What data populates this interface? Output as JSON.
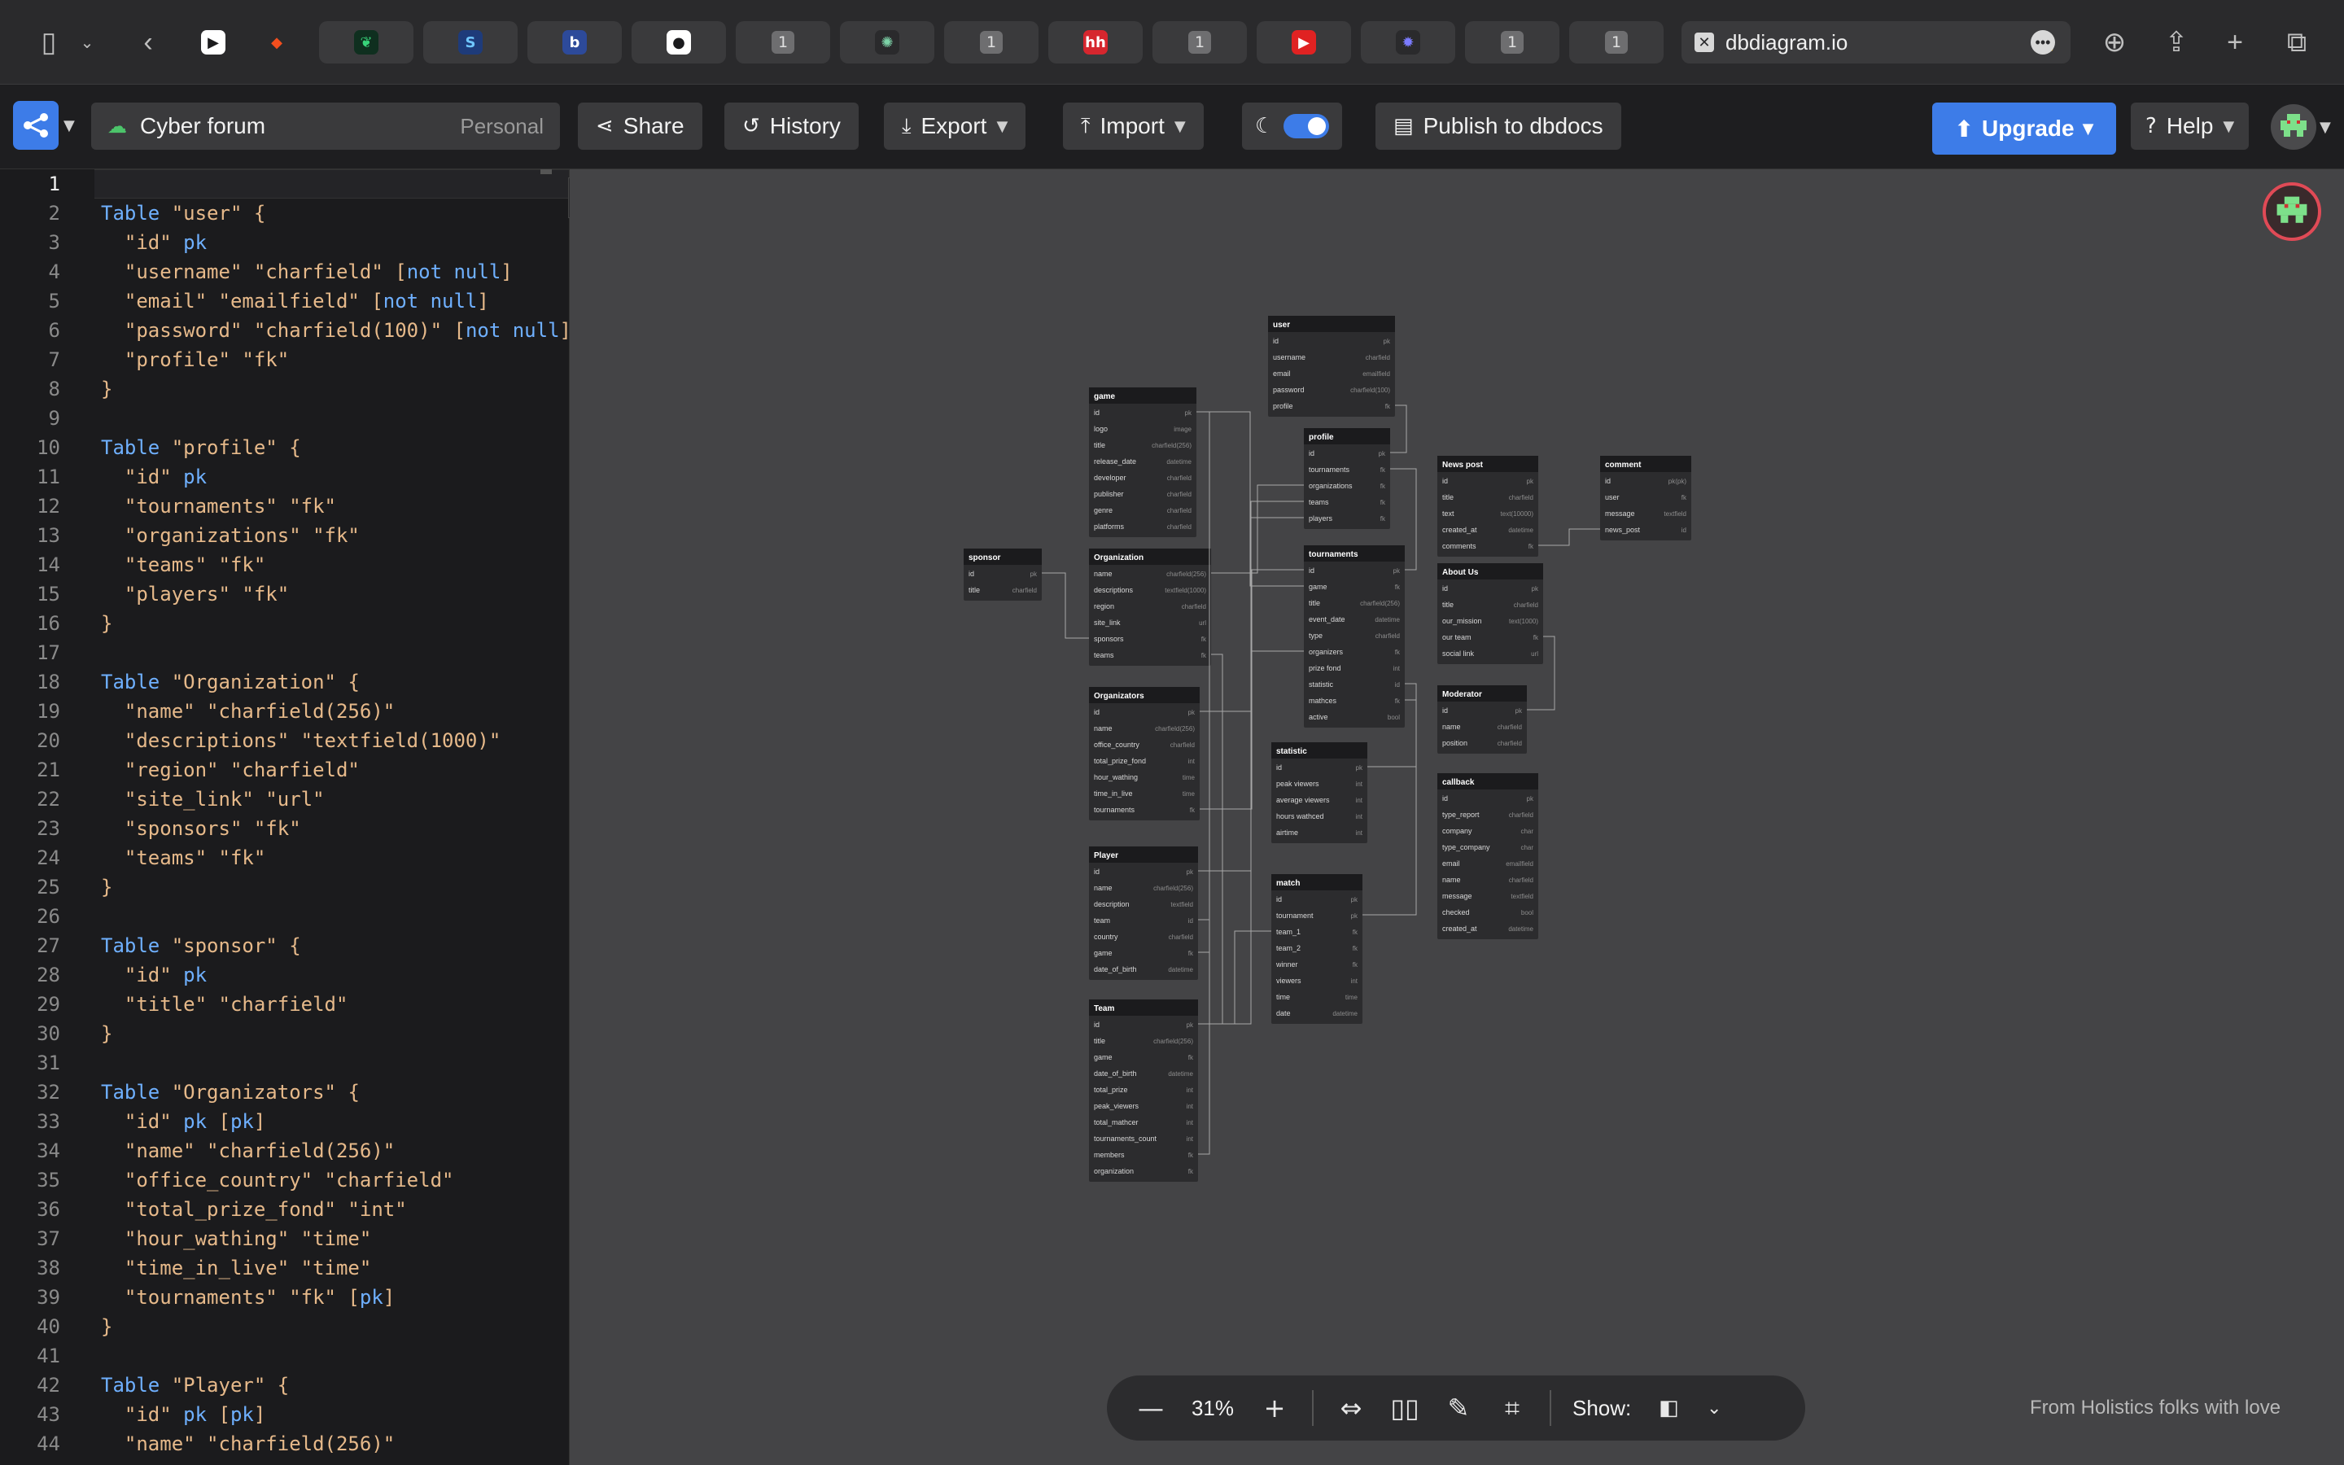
{
  "browser": {
    "url": "dbdiagram.io",
    "tab_count_label": "1",
    "tabs": [
      {
        "icon": "play-logo-icon",
        "color": "#ffffff",
        "glyph": "▶",
        "fg": "#1b1b1d"
      },
      {
        "icon": "figma-logo-icon",
        "color": "#2a2a2c",
        "glyph": "◆",
        "fg": "#f24e1e"
      },
      {
        "icon": "leaf-logo-icon",
        "color": "#0f2f1f",
        "glyph": "❦",
        "fg": "#38d47a"
      },
      {
        "icon": "s-logo-icon",
        "color": "#1e3b7a",
        "glyph": "S",
        "fg": "#6fc6ff"
      },
      {
        "icon": "b-logo-icon",
        "color": "#2d4a9a",
        "glyph": "b",
        "fg": "#ffffff"
      },
      {
        "icon": "github-logo-icon",
        "color": "#ffffff",
        "glyph": "●",
        "fg": "#1b1b1d"
      },
      {
        "icon": "numbered-tab-icon",
        "color": "",
        "glyph": "1",
        "fg": ""
      },
      {
        "icon": "openai-logo-icon",
        "color": "#2a2a2c",
        "glyph": "✺",
        "fg": "#7dd3a8"
      },
      {
        "icon": "numbered-tab-icon",
        "color": "",
        "glyph": "1",
        "fg": ""
      },
      {
        "icon": "hh-logo-icon",
        "color": "#d6262e",
        "glyph": "hh",
        "fg": "#ffffff"
      },
      {
        "icon": "numbered-tab-icon",
        "color": "",
        "glyph": "1",
        "fg": ""
      },
      {
        "icon": "youtube-logo-icon",
        "color": "#e02222",
        "glyph": "▶",
        "fg": "#ffffff"
      },
      {
        "icon": "bug-logo-icon",
        "color": "#2a2a2c",
        "glyph": "✹",
        "fg": "#7b7bff"
      },
      {
        "icon": "numbered-tab-icon",
        "color": "",
        "glyph": "1",
        "fg": ""
      },
      {
        "icon": "numbered-tab-icon",
        "color": "",
        "glyph": "1",
        "fg": ""
      }
    ]
  },
  "toolbar": {
    "project_name": "Cyber forum",
    "visibility": "Personal",
    "share": "Share",
    "history": "History",
    "export": "Export",
    "import": "Import",
    "publish": "Publish to dbdocs",
    "upgrade": "Upgrade",
    "help": "Help",
    "dark_mode_on": true
  },
  "editor": {
    "current_line": 1,
    "lines": [
      "",
      "Table \"user\" {",
      "  \"id\" pk",
      "  \"username\" \"charfield\" [not null]",
      "  \"email\" \"emailfield\" [not null]",
      "  \"password\" \"charfield(100)\" [not null]",
      "  \"profile\" \"fk\"",
      "}",
      "",
      "Table \"profile\" {",
      "  \"id\" pk",
      "  \"tournaments\" \"fk\"",
      "  \"organizations\" \"fk\"",
      "  \"teams\" \"fk\"",
      "  \"players\" \"fk\"",
      "}",
      "",
      "Table \"Organization\" {",
      "  \"name\" \"charfield(256)\"",
      "  \"descriptions\" \"textfield(1000)\"",
      "  \"region\" \"charfield\"",
      "  \"site_link\" \"url\"",
      "  \"sponsors\" \"fk\"",
      "  \"teams\" \"fk\"",
      "}",
      "",
      "Table \"sponsor\" {",
      "  \"id\" pk",
      "  \"title\" \"charfield\"",
      "}",
      "",
      "Table \"Organizators\" {",
      "  \"id\" pk [pk]",
      "  \"name\" \"charfield(256)\"",
      "  \"office_country\" \"charfield\"",
      "  \"total_prize_fond\" \"int\"",
      "  \"hour_wathing\" \"time\"",
      "  \"time_in_live\" \"time\"",
      "  \"tournaments\" \"fk\" [pk]",
      "}",
      "",
      "Table \"Player\" {",
      "  \"id\" pk [pk]",
      "  \"name\" \"charfield(256)\""
    ]
  },
  "diagram": {
    "tables": [
      {
        "name": "user",
        "fields": [
          [
            "id",
            "pk"
          ],
          [
            "username",
            "charfield"
          ],
          [
            "email",
            "emailfield"
          ],
          [
            "password",
            "charfield(100)"
          ],
          [
            "profile",
            "fk"
          ]
        ]
      },
      {
        "name": "game",
        "fields": [
          [
            "id",
            "pk"
          ],
          [
            "logo",
            "image"
          ],
          [
            "title",
            "charfield(256)"
          ],
          [
            "release_date",
            "datetime"
          ],
          [
            "developer",
            "charfield"
          ],
          [
            "publisher",
            "charfield"
          ],
          [
            "genre",
            "charfield"
          ],
          [
            "platforms",
            "charfield"
          ]
        ]
      },
      {
        "name": "profile",
        "fields": [
          [
            "id",
            "pk"
          ],
          [
            "tournaments",
            "fk"
          ],
          [
            "organizations",
            "fk"
          ],
          [
            "teams",
            "fk"
          ],
          [
            "players",
            "fk"
          ]
        ]
      },
      {
        "name": "News post",
        "fields": [
          [
            "id",
            "pk"
          ],
          [
            "title",
            "charfield"
          ],
          [
            "text",
            "text(10000)"
          ],
          [
            "created_at",
            "datetime"
          ],
          [
            "comments",
            "fk"
          ]
        ]
      },
      {
        "name": "comment",
        "fields": [
          [
            "id",
            "pk(pk)"
          ],
          [
            "user",
            "fk"
          ],
          [
            "message",
            "textfield"
          ],
          [
            "news_post",
            "id"
          ]
        ]
      },
      {
        "name": "sponsor",
        "fields": [
          [
            "id",
            "pk"
          ],
          [
            "title",
            "charfield"
          ]
        ]
      },
      {
        "name": "Organization",
        "fields": [
          [
            "name",
            "charfield(256)"
          ],
          [
            "descriptions",
            "textfield(1000)"
          ],
          [
            "region",
            "charfield"
          ],
          [
            "site_link",
            "url"
          ],
          [
            "sponsors",
            "fk"
          ],
          [
            "teams",
            "fk"
          ]
        ]
      },
      {
        "name": "tournaments",
        "fields": [
          [
            "id",
            "pk"
          ],
          [
            "game",
            "fk"
          ],
          [
            "title",
            "charfield(256)"
          ],
          [
            "event_date",
            "datetime"
          ],
          [
            "type",
            "charfield"
          ],
          [
            "organizers",
            "fk"
          ],
          [
            "prize fond",
            "int"
          ],
          [
            "statistic",
            "id"
          ],
          [
            "mathces",
            "fk"
          ],
          [
            "active",
            "bool"
          ]
        ]
      },
      {
        "name": "About Us",
        "fields": [
          [
            "id",
            "pk"
          ],
          [
            "title",
            "charfield"
          ],
          [
            "our_mission",
            "text(1000)"
          ],
          [
            "our team",
            "fk"
          ],
          [
            "social link",
            "url"
          ]
        ]
      },
      {
        "name": "Organizators",
        "fields": [
          [
            "id",
            "pk"
          ],
          [
            "name",
            "charfield(256)"
          ],
          [
            "office_country",
            "charfield"
          ],
          [
            "total_prize_fond",
            "int"
          ],
          [
            "hour_wathing",
            "time"
          ],
          [
            "time_in_live",
            "time"
          ],
          [
            "tournaments",
            "fk"
          ]
        ]
      },
      {
        "name": "Moderator",
        "fields": [
          [
            "id",
            "pk"
          ],
          [
            "name",
            "charfield"
          ],
          [
            "position",
            "charfield"
          ]
        ]
      },
      {
        "name": "statistic",
        "fields": [
          [
            "id",
            "pk"
          ],
          [
            "peak viewers",
            "int"
          ],
          [
            "average viewers",
            "int"
          ],
          [
            "hours wathced",
            "int"
          ],
          [
            "airtime",
            "int"
          ]
        ]
      },
      {
        "name": "callback",
        "fields": [
          [
            "id",
            "pk"
          ],
          [
            "type_report",
            "charfield"
          ],
          [
            "company",
            "char"
          ],
          [
            "type_company",
            "char"
          ],
          [
            "email",
            "emailfield"
          ],
          [
            "name",
            "charfield"
          ],
          [
            "message",
            "textfield"
          ],
          [
            "checked",
            "bool"
          ],
          [
            "created_at",
            "datetime"
          ]
        ]
      },
      {
        "name": "Player",
        "fields": [
          [
            "id",
            "pk"
          ],
          [
            "name",
            "charfield(256)"
          ],
          [
            "description",
            "textfield"
          ],
          [
            "team",
            "id"
          ],
          [
            "country",
            "charfield"
          ],
          [
            "game",
            "fk"
          ],
          [
            "date_of_birth",
            "datetime"
          ]
        ]
      },
      {
        "name": "match",
        "fields": [
          [
            "id",
            "pk"
          ],
          [
            "tournament",
            "pk"
          ],
          [
            "team_1",
            "fk"
          ],
          [
            "team_2",
            "fk"
          ],
          [
            "winner",
            "fk"
          ],
          [
            "viewers",
            "int"
          ],
          [
            "time",
            "time"
          ],
          [
            "date",
            "datetime"
          ]
        ]
      },
      {
        "name": "Team",
        "fields": [
          [
            "id",
            "pk"
          ],
          [
            "title",
            "charfield(256)"
          ],
          [
            "game",
            "fk"
          ],
          [
            "date_of_birth",
            "datetime"
          ],
          [
            "total_prize",
            "int"
          ],
          [
            "peak_viewers",
            "int"
          ],
          [
            "total_mathcer",
            "int"
          ],
          [
            "tournaments_count",
            "int"
          ],
          [
            "members",
            "fk"
          ],
          [
            "organization",
            "fk"
          ]
        ]
      }
    ]
  },
  "zoom": {
    "value": "31%",
    "show_label": "Show:"
  },
  "footer": {
    "credit": "From Holistics folks with love"
  },
  "colors": {
    "accent": "#3d7ce8",
    "canvas": "#444446",
    "table_header": "#1b1b1d",
    "table_body": "#2c2c2e"
  }
}
